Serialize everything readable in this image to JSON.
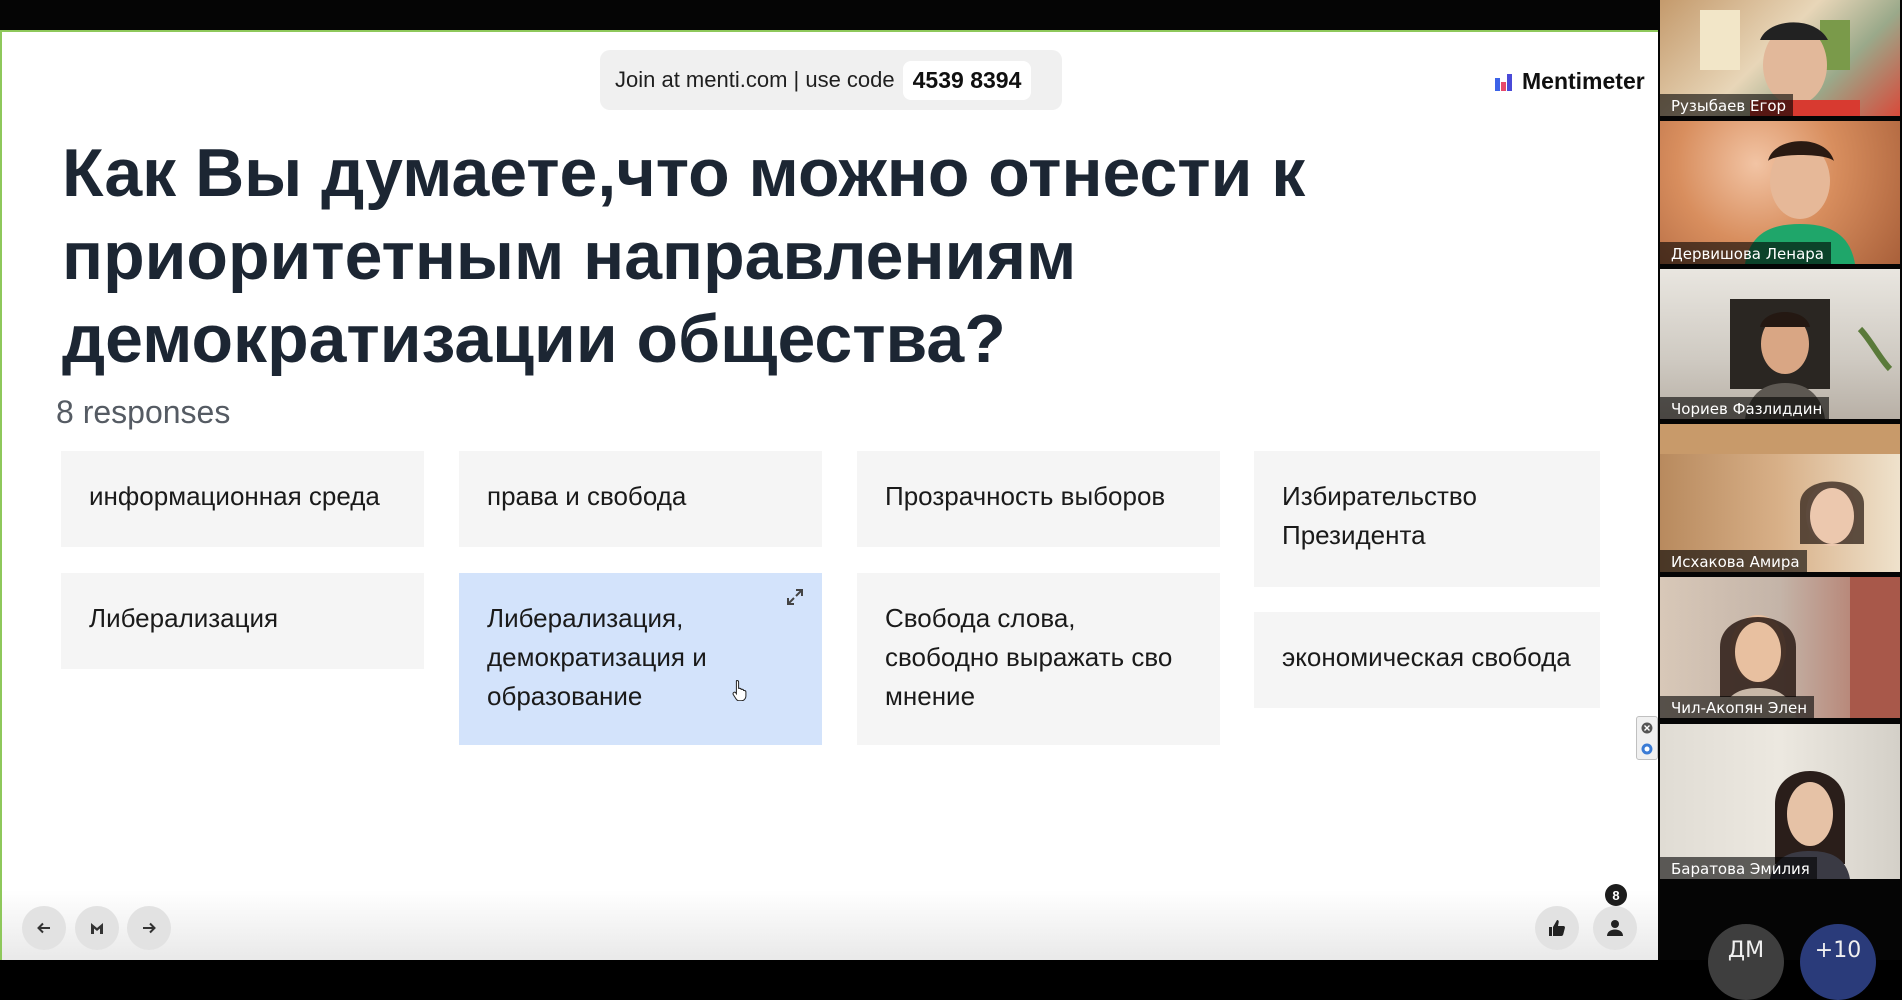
{
  "join": {
    "text": "Join at menti.com | use code",
    "code": "4539 8394"
  },
  "brand": {
    "name": "Mentimeter",
    "icon": "mentimeter-logo-icon"
  },
  "question": "Как Вы думаете,что можно отнести к приоритетным направлениям демократизации общества?",
  "response_count": "8 responses",
  "responses": [
    "информационная среда",
    "права и свобода",
    "Прозрачность выборов",
    "Избирательство Президента",
    "Либерализация",
    "Либерализация, демократизация и образование",
    "Свобода слова, свободно выражать сво мнение",
    "экономическая свобода"
  ],
  "controls": {
    "prev_icon": "arrow-left-icon",
    "logo_icon": "mentimeter-menu-icon",
    "next_icon": "arrow-right-icon",
    "reactions_icon": "thumbs-up-icon",
    "participants_icon": "person-icon",
    "participant_count": "8"
  },
  "participants": [
    {
      "name": "Рузыбаев Егор"
    },
    {
      "name": "Дервишова  Ленара"
    },
    {
      "name": "Чориев Фазлиддин"
    },
    {
      "name": "Исхакова Амира"
    },
    {
      "name": "Чил-Акопян  Элен"
    },
    {
      "name": "Баратова Эмилия"
    }
  ],
  "overflow": {
    "initials": "ДМ",
    "more": "+10"
  },
  "colors": {
    "accent_border": "#8ec85b",
    "selected_card": "#d3e3fb",
    "card": "#f5f5f5",
    "question_text": "#1c2633"
  }
}
